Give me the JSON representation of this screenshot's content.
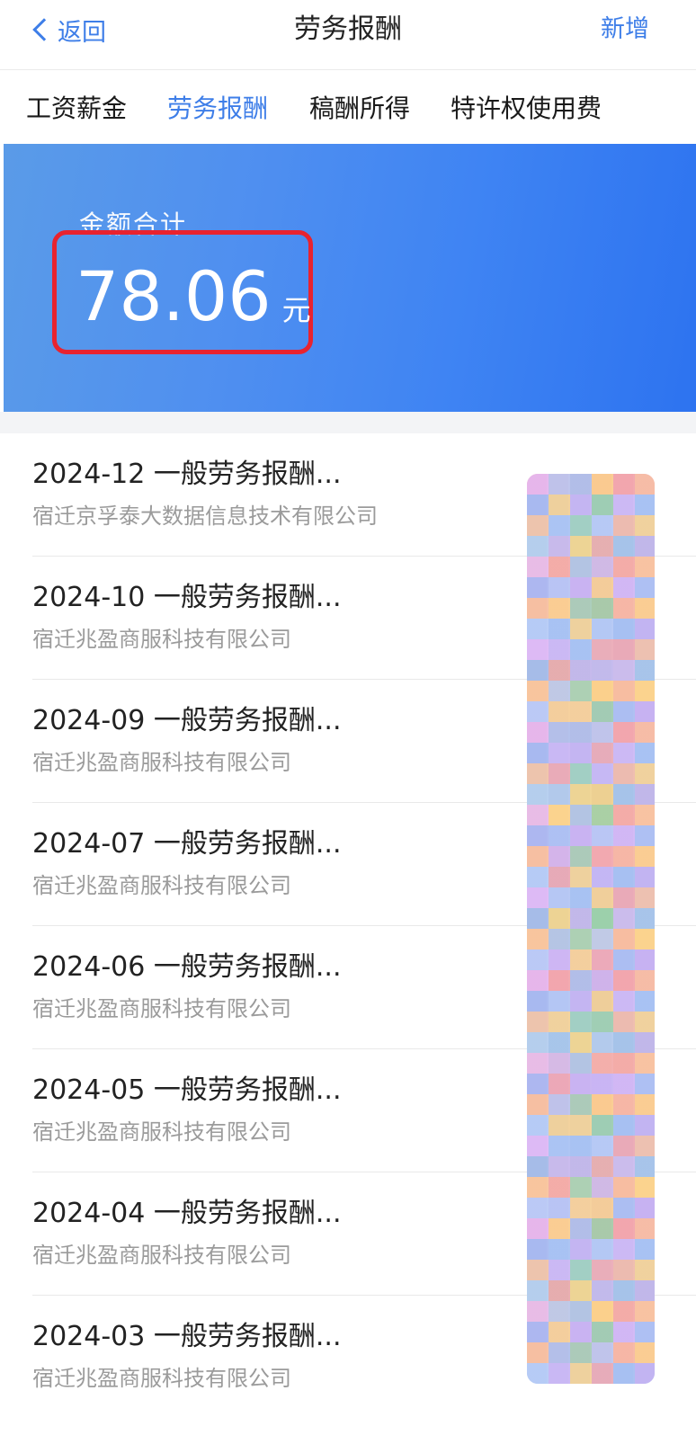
{
  "navbar": {
    "back_label": "返回",
    "title": "劳务报酬",
    "add_label": "新增"
  },
  "tabs": [
    {
      "label": "工资薪金",
      "active": false
    },
    {
      "label": "劳务报酬",
      "active": true
    },
    {
      "label": "稿酬所得",
      "active": false
    },
    {
      "label": "特许权使用费",
      "active": false
    }
  ],
  "summary": {
    "label": "金额合计",
    "amount": "78.06",
    "unit": "元"
  },
  "records": [
    {
      "title": "2024-12 一般劳务报酬...",
      "company": "宿迁京孚泰大数据信息技术有限公司"
    },
    {
      "title": "2024-10 一般劳务报酬...",
      "company": "宿迁兆盈商服科技有限公司"
    },
    {
      "title": "2024-09 一般劳务报酬...",
      "company": "宿迁兆盈商服科技有限公司"
    },
    {
      "title": "2024-07 一般劳务报酬...",
      "company": "宿迁兆盈商服科技有限公司"
    },
    {
      "title": "2024-06 一般劳务报酬...",
      "company": "宿迁兆盈商服科技有限公司"
    },
    {
      "title": "2024-05 一般劳务报酬...",
      "company": "宿迁兆盈商服科技有限公司"
    },
    {
      "title": "2024-04 一般劳务报酬...",
      "company": "宿迁兆盈商服科技有限公司"
    },
    {
      "title": "2024-03 一般劳务报酬...",
      "company": "宿迁兆盈商服科技有限公司"
    }
  ],
  "colors": {
    "accent": "#3e7ee8",
    "banner": "#3f84f3",
    "highlight_box": "#e8232f"
  }
}
